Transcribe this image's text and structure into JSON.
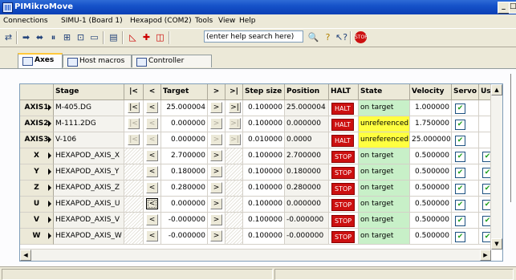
{
  "window": {
    "title": "PIMikroMove"
  },
  "menu": [
    "Connections",
    "SIMU-1 (Board 1)",
    "Hexapod (COM2)",
    "Tools",
    "View",
    "Help"
  ],
  "toolbar": {
    "search_placeholder": "(enter help search here)"
  },
  "tabs": [
    {
      "label": "Axes",
      "active": true
    },
    {
      "label": "Host macros",
      "active": false
    },
    {
      "label": "Controller macros",
      "active": false
    }
  ],
  "table": {
    "headers": {
      "stage": "Stage",
      "left_end": "|<",
      "left": "<",
      "target": "Target",
      "right": ">",
      "right_end": ">|",
      "step": "Step size",
      "position": "Position",
      "halt": "HALT",
      "state": "State",
      "velocity": "Velocity",
      "servo": "Servo",
      "use": "Use"
    },
    "rows": [
      {
        "axis": "AXIS1",
        "stage": "M-405.DG",
        "target": "25.000004",
        "step": "0.100000",
        "position": "25.000004",
        "halt": "HALT",
        "state": "on target",
        "velocity": "1.000000",
        "servo": true,
        "use": null,
        "enabled": true,
        "has_end": true
      },
      {
        "axis": "AXIS2",
        "stage": "M-111.2DG",
        "target": "0.000000",
        "step": "0.100000",
        "position": "0.000000",
        "halt": "HALT",
        "state": "unreferenced",
        "velocity": "1.750000",
        "servo": true,
        "use": null,
        "enabled": false,
        "has_end": true
      },
      {
        "axis": "AXIS3",
        "stage": "V-106",
        "target": "0.000000",
        "step": "0.010000",
        "position": "0.0000",
        "halt": "HALT",
        "state": "unreferenced",
        "velocity": "25.000000",
        "servo": true,
        "use": null,
        "enabled": false,
        "has_end": true
      },
      {
        "axis": "X",
        "stage": "HEXAPOD_AXIS_X",
        "target": "2.700000",
        "step": "0.100000",
        "position": "2.700000",
        "halt": "STOP",
        "state": "on target",
        "velocity": "0.500000",
        "servo": true,
        "use": true,
        "enabled": true,
        "has_end": false
      },
      {
        "axis": "Y",
        "stage": "HEXAPOD_AXIS_Y",
        "target": "0.180000",
        "step": "0.100000",
        "position": "0.180000",
        "halt": "STOP",
        "state": "on target",
        "velocity": "0.500000",
        "servo": true,
        "use": true,
        "enabled": true,
        "has_end": false
      },
      {
        "axis": "Z",
        "stage": "HEXAPOD_AXIS_Z",
        "target": "0.280000",
        "step": "0.100000",
        "position": "0.280000",
        "halt": "STOP",
        "state": "on target",
        "velocity": "0.500000",
        "servo": true,
        "use": true,
        "enabled": true,
        "has_end": false
      },
      {
        "axis": "U",
        "stage": "HEXAPOD_AXIS_U",
        "target": "0.000000",
        "step": "0.100000",
        "position": "0.000000",
        "halt": "STOP",
        "state": "on target",
        "velocity": "0.500000",
        "servo": true,
        "use": true,
        "enabled": true,
        "has_end": false,
        "focused": true
      },
      {
        "axis": "V",
        "stage": "HEXAPOD_AXIS_V",
        "target": "-0.000000",
        "step": "0.100000",
        "position": "-0.000000",
        "halt": "STOP",
        "state": "on target",
        "velocity": "0.500000",
        "servo": true,
        "use": true,
        "enabled": true,
        "has_end": false
      },
      {
        "axis": "W",
        "stage": "HEXAPOD_AXIS_W",
        "target": "-0.000000",
        "step": "0.100000",
        "position": "-0.000000",
        "halt": "STOP",
        "state": "on target",
        "velocity": "0.500000",
        "servo": true,
        "use": true,
        "enabled": true,
        "has_end": false
      }
    ]
  },
  "colors": {
    "halt": "#cc1010",
    "on_target": "#c8f0c8",
    "unreferenced": "#ffff40",
    "titlebar": "#1652c9"
  }
}
